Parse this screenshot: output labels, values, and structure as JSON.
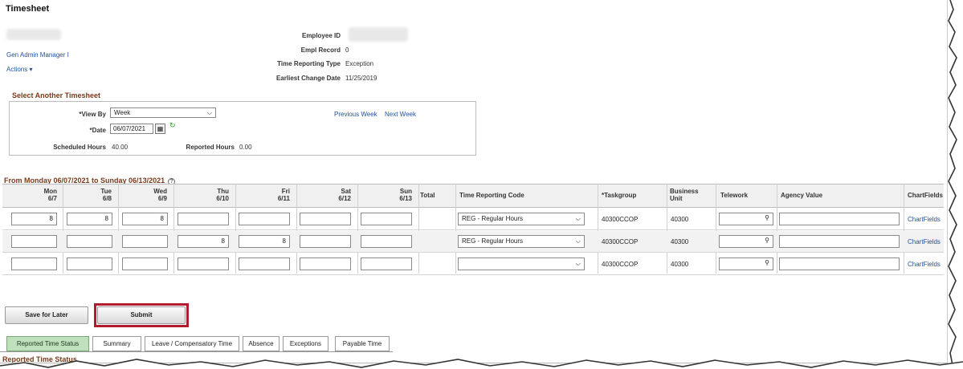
{
  "page": {
    "title": "Timesheet",
    "job_title": "Gen Admin Manager I",
    "actions_label": "Actions ▾"
  },
  "employee": {
    "id_label": "Employee ID",
    "id_value": "",
    "record_label": "Empl Record",
    "record_value": "0",
    "trt_label": "Time Reporting Type",
    "trt_value": "Exception",
    "ecd_label": "Earliest Change Date",
    "ecd_value": "11/25/2019"
  },
  "select_timesheet": {
    "header": "Select Another Timesheet",
    "view_by_label": "*View By",
    "view_by_value": "Week",
    "date_label": "*Date",
    "date_value": "06/07/2021",
    "prev_week": "Previous Week",
    "next_week": "Next Week",
    "scheduled_label": "Scheduled Hours",
    "scheduled_value": "40.00",
    "reported_label": "Reported Hours",
    "reported_value": "0.00"
  },
  "period": {
    "label": "From Monday 06/07/2021 to Sunday 06/13/2021",
    "help": "?"
  },
  "grid": {
    "headers": {
      "mon": [
        "Mon",
        "6/7"
      ],
      "tue": [
        "Tue",
        "6/8"
      ],
      "wed": [
        "Wed",
        "6/9"
      ],
      "thu": [
        "Thu",
        "6/10"
      ],
      "fri": [
        "Fri",
        "6/11"
      ],
      "sat": [
        "Sat",
        "6/12"
      ],
      "sun": [
        "Sun",
        "6/13"
      ],
      "total": "Total",
      "trc": "Time Reporting Code",
      "taskgroup": "*Taskgroup",
      "bu": [
        "Business",
        "Unit"
      ],
      "telework": "Telework",
      "agency": "Agency Value",
      "chartfields": "ChartFields"
    },
    "rows": [
      {
        "mon": "8",
        "tue": "8",
        "wed": "8",
        "thu": "",
        "fri": "",
        "sat": "",
        "sun": "",
        "trc": "REG - Regular Hours",
        "taskgroup": "40300CCOP",
        "bu": "40300",
        "cf": "ChartFields"
      },
      {
        "mon": "",
        "tue": "",
        "wed": "",
        "thu": "8",
        "fri": "8",
        "sat": "",
        "sun": "",
        "trc": "REG - Regular Hours",
        "taskgroup": "40300CCOP",
        "bu": "40300",
        "cf": "ChartFields"
      },
      {
        "mon": "",
        "tue": "",
        "wed": "",
        "thu": "",
        "fri": "",
        "sat": "",
        "sun": "",
        "trc": "",
        "taskgroup": "40300CCOP",
        "bu": "40300",
        "cf": "ChartFields"
      }
    ]
  },
  "buttons": {
    "save_later": "Save for Later",
    "submit": "Submit"
  },
  "tabs": [
    {
      "label": "Reported Time Status",
      "active": true
    },
    {
      "label": "Summary"
    },
    {
      "label": "Leave / Compensatory Time"
    },
    {
      "label": "Absence"
    },
    {
      "label": "Exceptions"
    },
    {
      "label": "Payable Time"
    }
  ],
  "bottom": {
    "header": "Reported Time Status"
  },
  "colors": {
    "section_header": "#7a3a1a",
    "link": "#1f4f9e",
    "active_tab": "#bfe0bd",
    "highlight": "#b31b2e"
  }
}
